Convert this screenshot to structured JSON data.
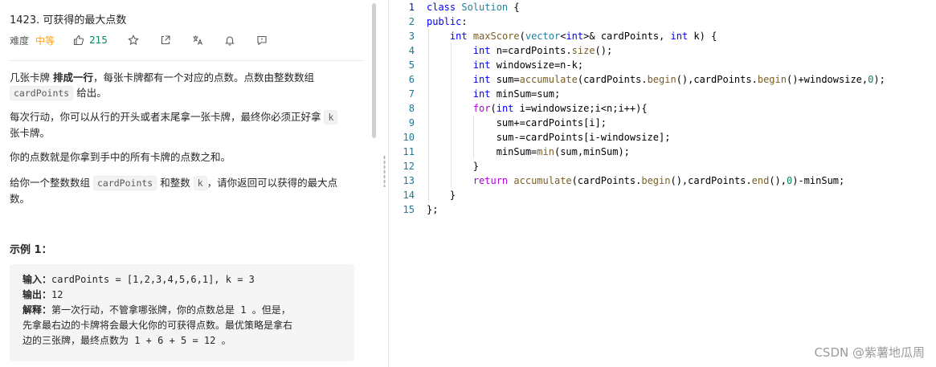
{
  "problem": {
    "title": "1423. 可获得的最大点数",
    "difficulty_label": "难度",
    "difficulty": "中等",
    "likes": "215",
    "desc_p1_pre": "几张卡牌 ",
    "desc_p1_bold": "排成一行",
    "desc_p1_mid": "，每张卡牌都有一个对应的点数。点数由整数数组",
    "desc_p1_code": "cardPoints",
    "desc_p1_post": " 给出。",
    "desc_p2_pre": "每次行动，你可以从行的开头或者末尾拿一张卡牌，最终你必须正好拿 ",
    "desc_p2_code": "k",
    "desc_p2_post": "张卡牌。",
    "desc_p3": "你的点数就是你拿到手中的所有卡牌的点数之和。",
    "desc_p4_pre": "给你一个整数数组 ",
    "desc_p4_code1": "cardPoints",
    "desc_p4_mid": " 和整数 ",
    "desc_p4_code2": "k",
    "desc_p4_post": "，请你返回可以获得的最大点数。",
    "example_title": "示例 1：",
    "ex_input_label": "输入：",
    "ex_input": "cardPoints = [1,2,3,4,5,6,1], k = 3",
    "ex_output_label": "输出：",
    "ex_output": "12",
    "ex_explain_label": "解释：",
    "ex_explain_1": "第一次行动，不管拿哪张牌，你的点数总是 1 。但是，",
    "ex_explain_2": "先拿最右边的卡牌将会最大化你的可获得点数。最优策略是拿右",
    "ex_explain_3": "边的三张牌，最终点数为 1 + 6 + 5 = 12 。"
  },
  "toolbar_icons": [
    "thumbs-up-icon",
    "star-icon",
    "share-icon",
    "translate-icon",
    "bell-icon",
    "comment-icon"
  ],
  "editor": {
    "line_numbers": [
      "1",
      "2",
      "3",
      "4",
      "5",
      "6",
      "7",
      "8",
      "9",
      "10",
      "11",
      "12",
      "13",
      "14",
      "15"
    ]
  },
  "watermark": "CSDN @紫薯地瓜周"
}
